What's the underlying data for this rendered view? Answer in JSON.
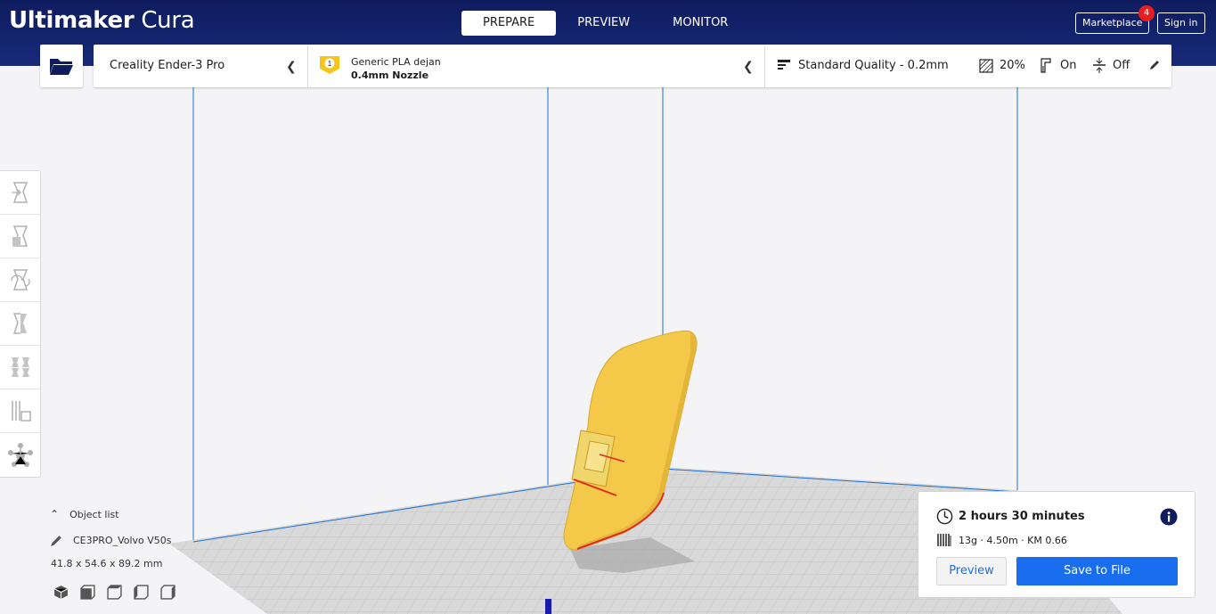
{
  "app": {
    "logo_bold": "Ultimaker",
    "logo_light": "Cura"
  },
  "stages": [
    {
      "label": "PREPARE",
      "active": true
    },
    {
      "label": "PREVIEW",
      "active": false
    },
    {
      "label": "MONITOR",
      "active": false
    }
  ],
  "header": {
    "marketplace_label": "Marketplace",
    "marketplace_badge": "4",
    "signin_label": "Sign in"
  },
  "printer": {
    "name": "Creality Ender-3 Pro"
  },
  "material": {
    "extruder_number": "1",
    "name": "Generic PLA dejan",
    "nozzle": "0.4mm Nozzle",
    "color": "#f5c518"
  },
  "profile": {
    "quality": "Standard Quality - 0.2mm",
    "infill": "20%",
    "support": "On",
    "adhesion": "Off"
  },
  "tools": [
    "move-tool",
    "scale-tool",
    "rotate-tool",
    "mirror-tool",
    "per-model-settings-tool",
    "support-blocker-tool",
    "custom-supports-tool"
  ],
  "object_list": {
    "header": "Object list",
    "file_name": "CE3PRO_Volvo V50s",
    "dimensions": "41.8 x 54.6 x 89.2 mm",
    "view_icons": [
      "3d-view-icon",
      "front-view-icon",
      "top-view-icon",
      "left-view-icon",
      "right-view-icon"
    ]
  },
  "print_summary": {
    "time": "2 hours 30 minutes",
    "material_usage": "13g · 4.50m · KM 0.66",
    "preview_label": "Preview",
    "save_label": "Save to File"
  },
  "colors": {
    "header": "#172a7a",
    "accent": "#196ef0",
    "model": "#f4c94a",
    "build_axis": "#1c6fd6"
  }
}
